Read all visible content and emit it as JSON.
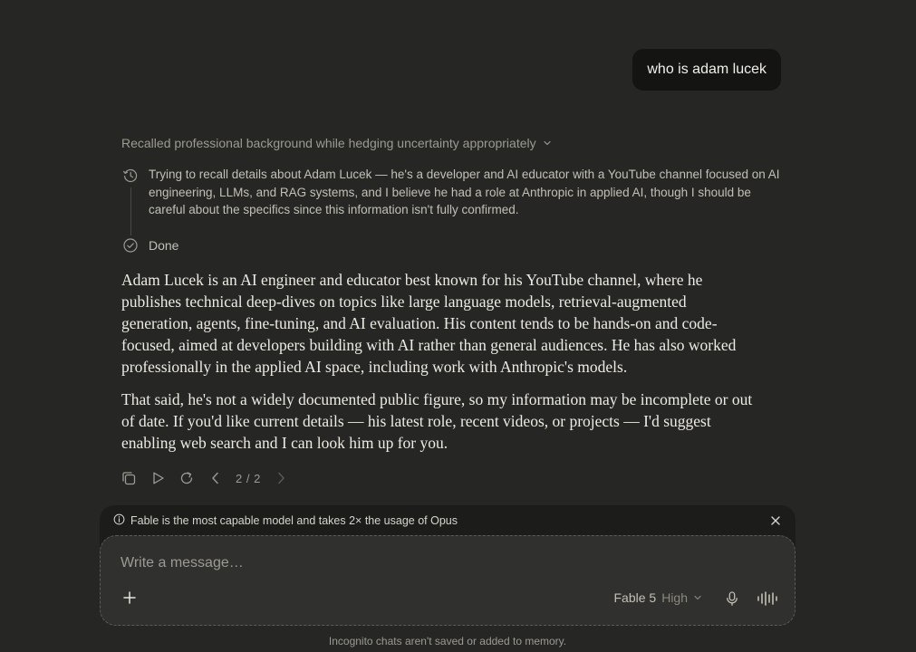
{
  "conversation": {
    "user_message": "who is adam lucek",
    "thinking": {
      "summary": "Recalled professional background while hedging uncertainty appropriately",
      "step_text": "Trying to recall details about Adam Lucek — he's a developer and AI educator with a YouTube channel focused on AI engineering, LLMs, and RAG systems, and I believe he had a role at Anthropic in applied AI, though I should be careful about the specifics since this information isn't fully confirmed.",
      "done_label": "Done"
    },
    "response": {
      "paragraphs": [
        "Adam Lucek is an AI engineer and educator best known for his YouTube channel, where he publishes technical deep-dives on topics like large language models, retrieval-augmented generation, agents, fine-tuning, and AI evaluation. His content tends to be hands-on and code-focused, aimed at developers building with AI rather than general audiences. He has also worked professionally in the applied AI space, including work with Anthropic's models.",
        "That said, he's not a widely documented public figure, so my information may be incomplete or out of date. If you'd like current details — his latest role, recent videos, or projects — I'd suggest enabling web search and I can look him up for you."
      ]
    },
    "actions": {
      "copy_icon": "copy-icon",
      "play_icon": "play-icon",
      "retry_icon": "retry-icon",
      "pager": "2 / 2"
    }
  },
  "notice": {
    "icon": "info-icon",
    "text": "Fable is the most capable model and takes 2× the usage of Opus"
  },
  "composer": {
    "placeholder": "Write a message…",
    "model_name": "Fable 5",
    "effort": "High"
  },
  "footer": {
    "text": "Incognito chats aren't saved or added to memory."
  }
}
